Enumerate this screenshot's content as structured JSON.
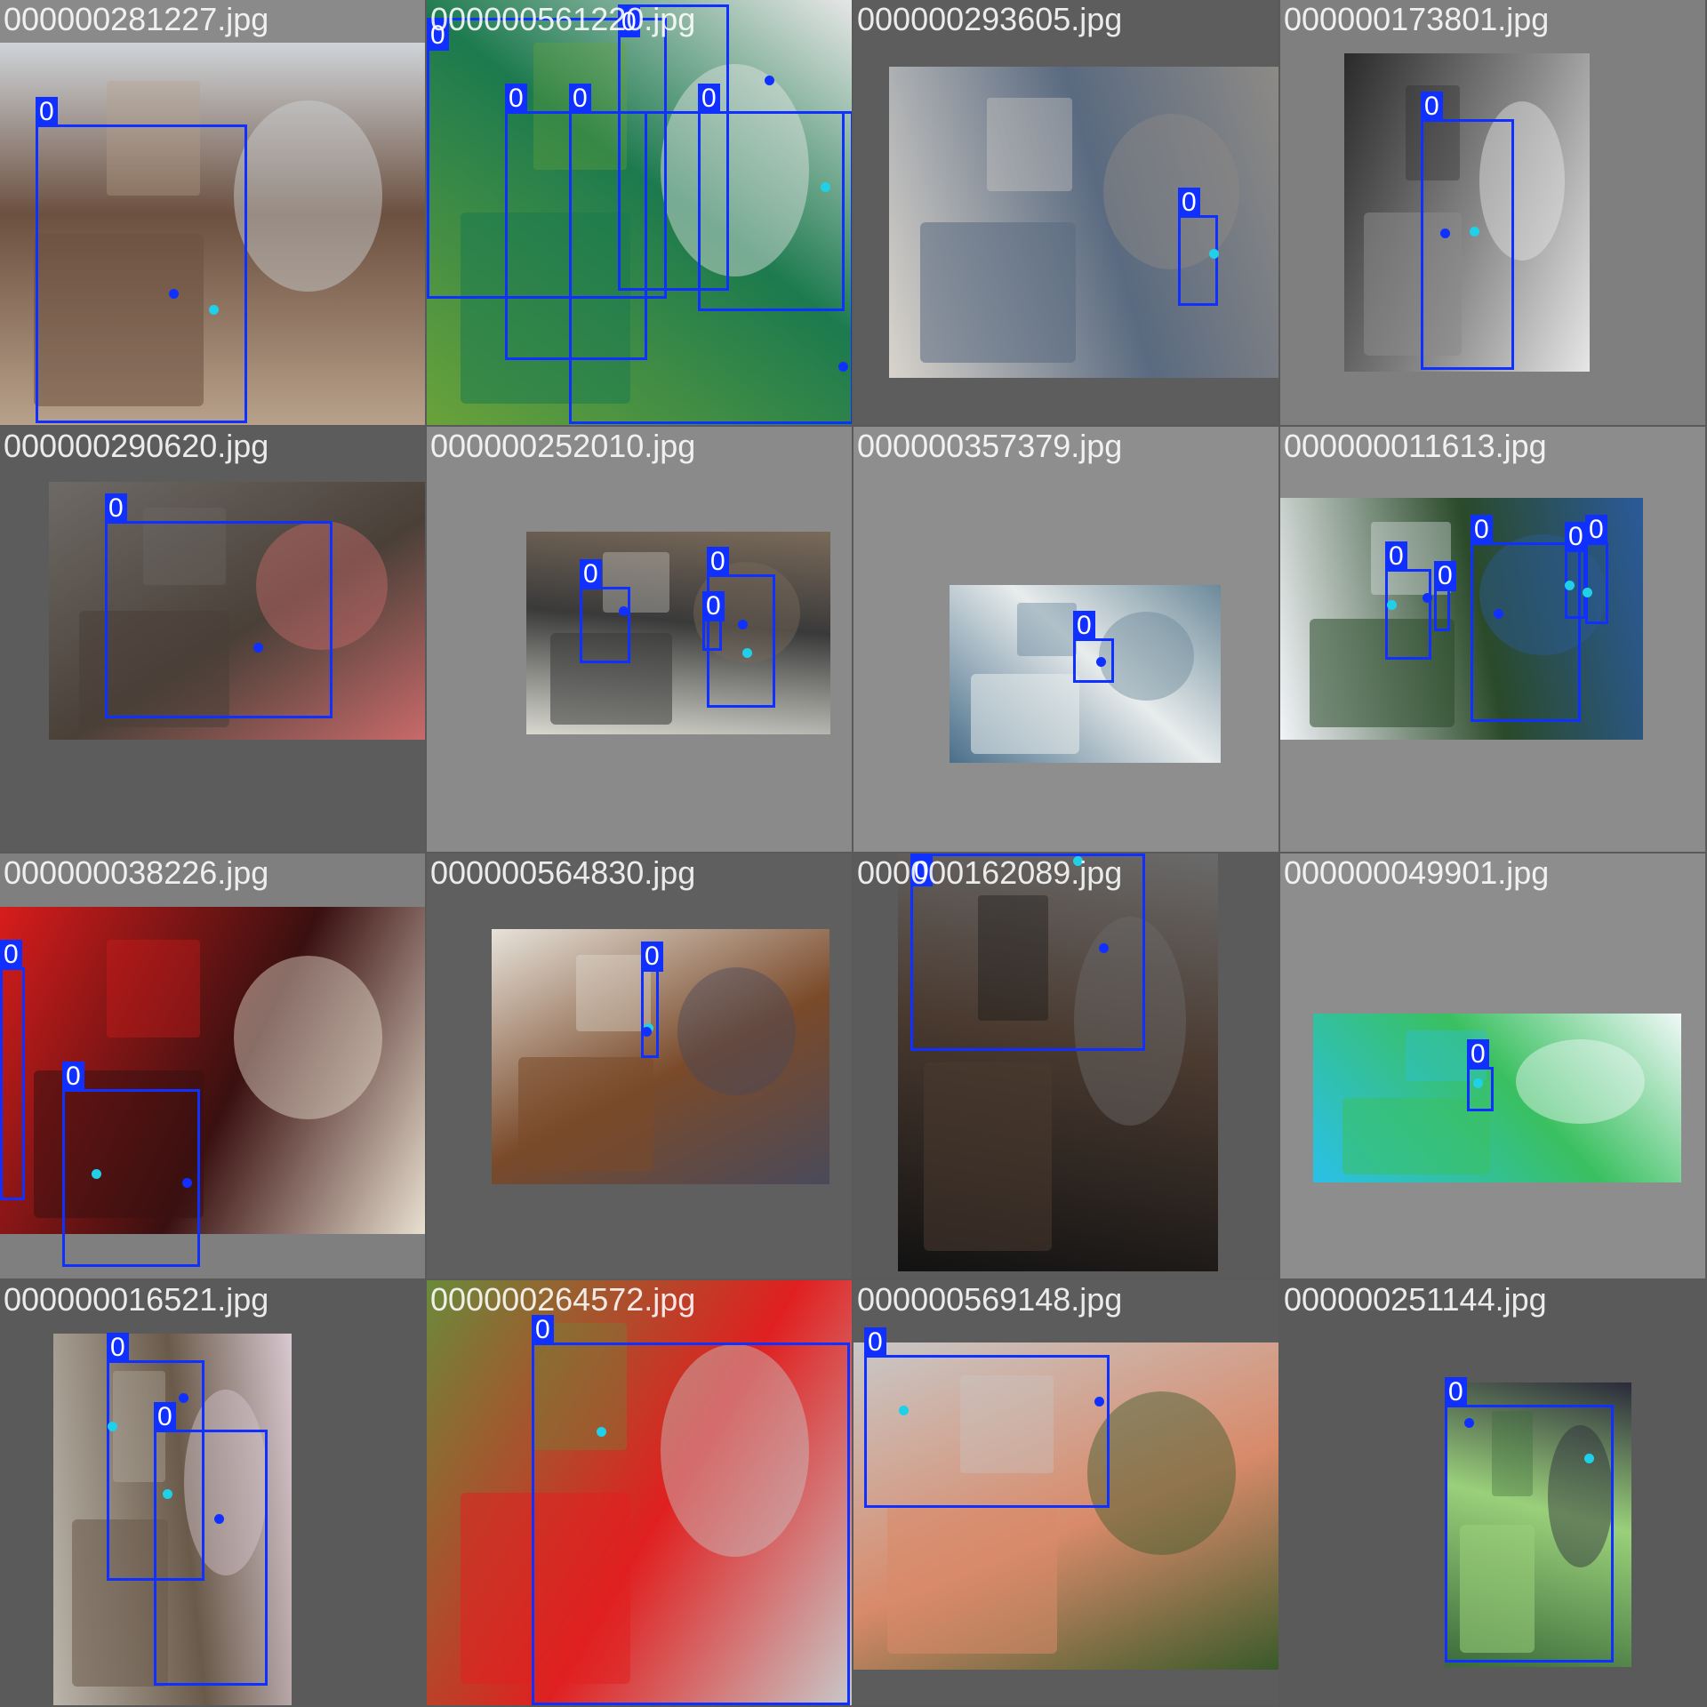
{
  "grid": {
    "tiles": [
      {
        "filename": "000000281227.jpg",
        "background": "#8a8a8a",
        "photo_colors": [
          "#b8a18a",
          "#6c5040",
          "#cfd4d8"
        ],
        "detections": [
          {
            "class_label": "0"
          }
        ]
      },
      {
        "filename": "000000561220.jpg",
        "background": "#3e7a44",
        "photo_colors": [
          "#6aa23a",
          "#1c7a4e",
          "#e6e6e6"
        ],
        "detections": [
          {
            "class_label": "0"
          },
          {
            "class_label": "0"
          },
          {
            "class_label": "0"
          },
          {
            "class_label": "0"
          },
          {
            "class_label": "0"
          }
        ]
      },
      {
        "filename": "000000293605.jpg",
        "background": "#5d5d5d",
        "photo_colors": [
          "#d9d4cc",
          "#5a6a80",
          "#8d8a86"
        ],
        "detections": [
          {
            "class_label": "0"
          }
        ]
      },
      {
        "filename": "000000173801.jpg",
        "background": "#7f7f7f",
        "photo_colors": [
          "#2a2a2a",
          "#8a8a8a",
          "#e6e6e6"
        ],
        "detections": [
          {
            "class_label": "0"
          }
        ]
      },
      {
        "filename": "000000290620.jpg",
        "background": "#5c5c5c",
        "photo_colors": [
          "#6e6a66",
          "#4a4038",
          "#c86a6a"
        ],
        "detections": [
          {
            "class_label": "0"
          }
        ]
      },
      {
        "filename": "000000252010.jpg",
        "background": "#8a8a8a",
        "photo_colors": [
          "#d8d8d0",
          "#3a3a3a",
          "#7a6a5a"
        ],
        "detections": [
          {
            "class_label": "0"
          },
          {
            "class_label": "0"
          },
          {
            "class_label": "0"
          }
        ]
      },
      {
        "filename": "000000357379.jpg",
        "background": "#8e8e8e",
        "photo_colors": [
          "#4a6f8a",
          "#e8ecec",
          "#6c8a9a"
        ],
        "detections": [
          {
            "class_label": "0"
          }
        ]
      },
      {
        "filename": "000000011613.jpg",
        "background": "#8c8c8c",
        "photo_colors": [
          "#f2f4f8",
          "#2a4a2a",
          "#2a5a9a"
        ],
        "detections": [
          {
            "class_label": "0"
          },
          {
            "class_label": "0"
          },
          {
            "class_label": "0"
          },
          {
            "class_label": "0"
          },
          {
            "class_label": "0"
          }
        ]
      },
      {
        "filename": "000000038226.jpg",
        "background": "#7f7f7f",
        "photo_colors": [
          "#d81c1c",
          "#3a1010",
          "#e8e0d0"
        ],
        "detections": [
          {
            "class_label": "0"
          },
          {
            "class_label": "0"
          }
        ]
      },
      {
        "filename": "000000564830.jpg",
        "background": "#5f5f5f",
        "photo_colors": [
          "#e6e2da",
          "#7a4a2a",
          "#4a4a5a"
        ],
        "detections": [
          {
            "class_label": "0"
          }
        ]
      },
      {
        "filename": "000000162089.jpg",
        "background": "#5b5b5b",
        "photo_colors": [
          "#121212",
          "#4a3a30",
          "#6a6a6a"
        ],
        "detections": [
          {
            "class_label": "0"
          }
        ]
      },
      {
        "filename": "000000049901.jpg",
        "background": "#8d8d8d",
        "photo_colors": [
          "#2ac0e8",
          "#3ac060",
          "#f0f8f8"
        ],
        "detections": [
          {
            "class_label": "0"
          }
        ]
      },
      {
        "filename": "000000016521.jpg",
        "background": "#5a5a5a",
        "photo_colors": [
          "#bab4aa",
          "#6a5a4a",
          "#d8c8d0"
        ],
        "detections": [
          {
            "class_label": "0"
          },
          {
            "class_label": "0"
          }
        ]
      },
      {
        "filename": "000000264572.jpg",
        "background": "#8a8a8a",
        "photo_colors": [
          "#6a8a3a",
          "#e02020",
          "#c8c8c8"
        ],
        "detections": [
          {
            "class_label": "0"
          }
        ]
      },
      {
        "filename": "000000569148.jpg",
        "background": "#5c5c5c",
        "photo_colors": [
          "#c8c8c8",
          "#d88a6a",
          "#3a5a2a"
        ],
        "detections": [
          {
            "class_label": "0"
          }
        ]
      },
      {
        "filename": "000000251144.jpg",
        "background": "#5a5a5a",
        "photo_colors": [
          "#3a6a3a",
          "#9ad07a",
          "#2a2a3a"
        ],
        "detections": [
          {
            "class_label": "0"
          }
        ]
      }
    ]
  },
  "colors": {
    "bbox": "#1030ff",
    "label_bg": "#1030ff",
    "label_text": "#ffffff",
    "keypoint_a": "#1030ff",
    "keypoint_b": "#20d0e8"
  }
}
